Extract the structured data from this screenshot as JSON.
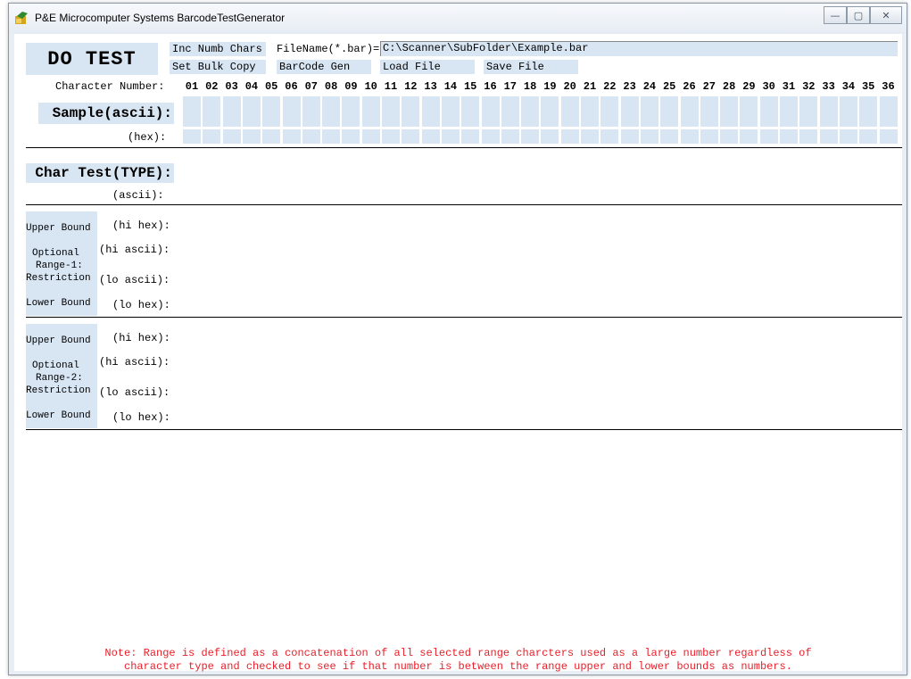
{
  "window": {
    "title": "P&E Microcomputer Systems BarcodeTestGenerator",
    "controls": {
      "minimize": "—",
      "maximize": "▢",
      "close": "✕"
    }
  },
  "toolbar": {
    "do_test": "DO TEST",
    "inc_numb_chars": "Inc Numb Chars",
    "set_bulk_copy": "Set Bulk Copy",
    "filename_label": "FileName(*.bar)=",
    "filename_value": "C:\\Scanner\\SubFolder\\Example.bar",
    "barcode_gen": "BarCode Gen",
    "load_file": "Load File",
    "save_file": "Save File"
  },
  "grid": {
    "character_number_label": "Character Number:",
    "columns": [
      "01",
      "02",
      "03",
      "04",
      "05",
      "06",
      "07",
      "08",
      "09",
      "10",
      "11",
      "12",
      "13",
      "14",
      "15",
      "16",
      "17",
      "18",
      "19",
      "20",
      "21",
      "22",
      "23",
      "24",
      "25",
      "26",
      "27",
      "28",
      "29",
      "30",
      "31",
      "32",
      "33",
      "34",
      "35",
      "36"
    ],
    "sample_ascii_label": "Sample(ascii):",
    "hex_label": "(hex):"
  },
  "char_test": {
    "type_label": "Char Test(TYPE):",
    "ascii_label": "(ascii):"
  },
  "range1": {
    "upper_bound": "Upper Bound",
    "optional": "Optional",
    "range_name": "Range-1:",
    "restriction": "Restriction",
    "lower_bound": "Lower Bound",
    "hi_hex": "(hi hex):",
    "hi_ascii": "(hi ascii):",
    "lo_ascii": "(lo ascii):",
    "lo_hex": "(lo hex):"
  },
  "range2": {
    "upper_bound": "Upper Bound",
    "optional": "Optional",
    "range_name": "Range-2:",
    "restriction": "Restriction",
    "lower_bound": "Lower Bound",
    "hi_hex": "(hi hex):",
    "hi_ascii": "(hi ascii):",
    "lo_ascii": "(lo ascii):",
    "lo_hex": "(lo hex):"
  },
  "note": {
    "line1": "Note: Range is defined as a concatenation of all selected range charcters used as a large number regardless of",
    "line2": "character type and checked to see if that number is between the range upper and lower bounds as numbers."
  },
  "colors": {
    "accent_bg": "#d8e5f3",
    "note_text": "#e8202a"
  }
}
